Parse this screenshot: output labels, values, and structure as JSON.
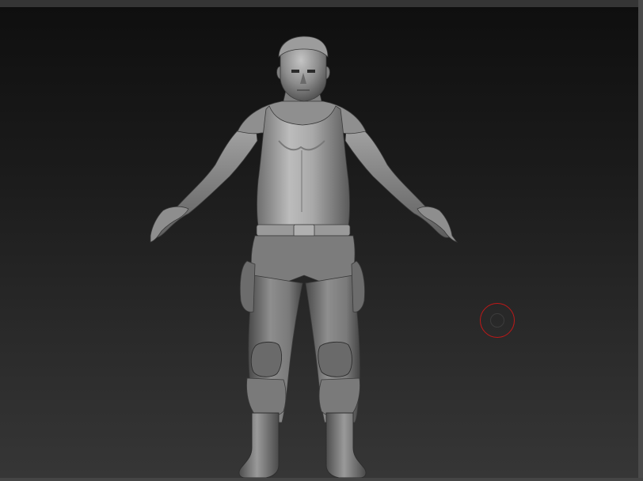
{
  "canvas": {
    "background_top": "#0f0f0f",
    "background_bottom": "#363636",
    "material_base": "#8a8a8a",
    "material_highlight": "#cfcfcf",
    "material_shadow": "#3c3c3c"
  },
  "model": {
    "pose": "A-pose",
    "outfit": [
      "tank-top",
      "belt",
      "cargo-pants",
      "knee-pads",
      "boots"
    ]
  },
  "brush_cursor": {
    "color": "#c01818",
    "icon": "brush-circle-icon"
  }
}
